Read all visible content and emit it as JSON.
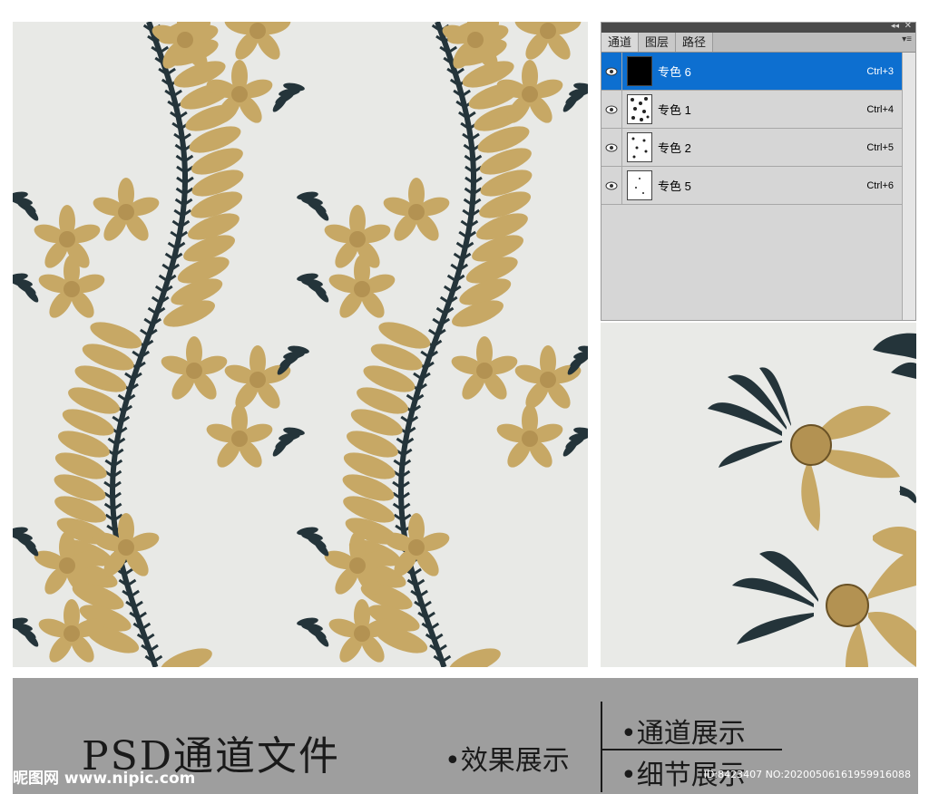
{
  "panel": {
    "tabs": [
      "通道",
      "图层",
      "路径"
    ],
    "channels": [
      {
        "name": "专色 6",
        "shortcut": "Ctrl+3",
        "selected": true
      },
      {
        "name": "专色 1",
        "shortcut": "Ctrl+4",
        "selected": false
      },
      {
        "name": "专色 2",
        "shortcut": "Ctrl+5",
        "selected": false
      },
      {
        "name": "专色 5",
        "shortcut": "Ctrl+6",
        "selected": false
      }
    ]
  },
  "banner": {
    "title": "PSD通道文件",
    "effect": "•效果展示",
    "channel_show": "•通道展示",
    "detail_show": "•细节展示",
    "logo": "昵图网 www.nipic.com",
    "id": "ID:8423407 NO:20200506161959916088"
  },
  "colors": {
    "gold": "#c7a865",
    "stem": "#24343a",
    "background": "#e8e9e6",
    "selected": "#0d6fd0"
  }
}
